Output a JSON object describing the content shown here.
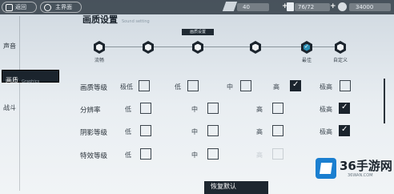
{
  "topbar": {
    "tab1": "返回",
    "tab2": "主界面",
    "res1_value": "40",
    "res2_value": "76/72",
    "res3_value": "34000",
    "plus": "+"
  },
  "sidebar": {
    "items": [
      {
        "label": "声音",
        "active": false
      },
      {
        "label": "画质",
        "sub": "Graphics",
        "active": true
      },
      {
        "label": "战斗",
        "active": false
      }
    ]
  },
  "header": {
    "title": "画质设置",
    "subtitle": "Sound setting"
  },
  "presets": {
    "tooltip": "画质设置",
    "items": [
      {
        "label": "流畅",
        "selected": false
      },
      {
        "label": "",
        "selected": false
      },
      {
        "label": "",
        "selected": false
      },
      {
        "label": "",
        "selected": false
      },
      {
        "label": "最佳",
        "selected": true
      },
      {
        "label": "自定义",
        "selected": false
      }
    ]
  },
  "settings": [
    {
      "label": "画质等级",
      "options": [
        {
          "text": "极低",
          "checked": false
        },
        {
          "text": "低",
          "checked": false
        },
        {
          "text": "中",
          "checked": false
        },
        {
          "text": "高",
          "checked": true
        },
        {
          "text": "极高",
          "checked": false
        }
      ]
    },
    {
      "label": "分辨率",
      "options": [
        {
          "text": "低",
          "checked": false
        },
        {
          "text": "中",
          "checked": false
        },
        {
          "text": "高",
          "checked": false
        },
        {
          "text": "极高",
          "checked": true
        }
      ]
    },
    {
      "label": "阴影等级",
      "options": [
        {
          "text": "低",
          "checked": false
        },
        {
          "text": "中",
          "checked": false
        },
        {
          "text": "高",
          "checked": false
        },
        {
          "text": "极高",
          "checked": true
        }
      ]
    },
    {
      "label": "特效等级",
      "options": [
        {
          "text": "低",
          "checked": false
        },
        {
          "text": "中",
          "checked": false
        },
        {
          "text": "高",
          "checked": false
        }
      ]
    }
  ],
  "reset_label": "恢复默认",
  "watermark": {
    "name": "36手游网",
    "url": "36WAN.COM"
  }
}
